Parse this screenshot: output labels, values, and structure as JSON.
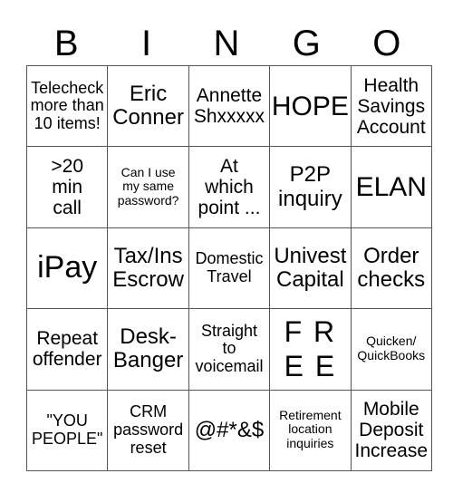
{
  "header": {
    "letters": [
      "B",
      "I",
      "N",
      "G",
      "O"
    ]
  },
  "grid": {
    "rows": [
      [
        "Telecheck\nmore than\n10 items!",
        "Eric\nConner",
        "Annette\nShxxxxx",
        "HOPE",
        "Health\nSavings\nAccount"
      ],
      [
        ">20\nmin\ncall",
        "Can I use\nmy same\npassword?",
        "At\nwhich\npoint ...",
        "P2P\ninquiry",
        "ELAN"
      ],
      [
        "iPay",
        "Tax/Ins\nEscrow",
        "Domestic\nTravel",
        "Univest\nCapital",
        "Order\nchecks"
      ],
      [
        "Repeat\noffender",
        "Desk-\nBanger",
        "Straight\nto\nvoicemail",
        "F R\nE E",
        "Quicken/\nQuickBooks"
      ],
      [
        "\"YOU\nPEOPLE\"",
        "CRM\npassword\nreset",
        "@#*&$",
        "Retirement\nlocation\ninquiries",
        "Mobile\nDeposit\nIncrease"
      ]
    ],
    "free_space": {
      "row": 3,
      "col": 3
    }
  }
}
